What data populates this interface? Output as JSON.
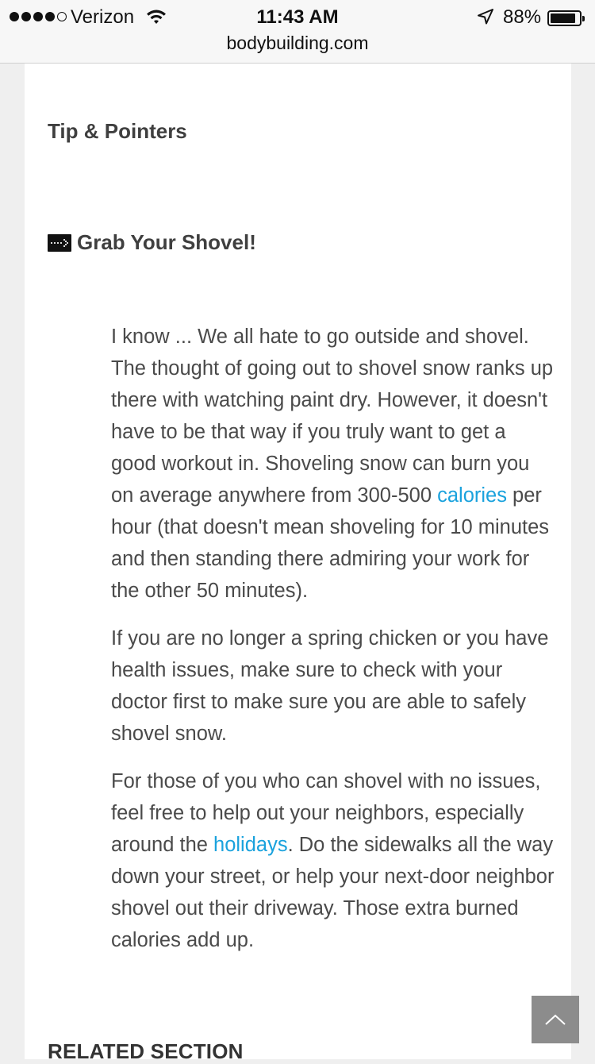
{
  "status_bar": {
    "carrier": "Verizon",
    "time": "11:43 AM",
    "battery_percent": "88%",
    "battery_level": 0.88,
    "url": "bodybuilding.com"
  },
  "article": {
    "section_title": "Tip & Pointers",
    "heading": "Grab Your Shovel!",
    "p1": {
      "before": "I know ... We all hate to go outside and shovel. The thought of going out to shovel snow ranks up there with watching paint dry. However, it doesn't have to be that way if you truly want to get a good workout in. Shoveling snow can burn you on average anywhere from 300-500 ",
      "link": "calories",
      "after": " per hour (that doesn't mean shoveling for 10 minutes and then standing there admiring your work for the other 50 minutes)."
    },
    "p2": "If you are no longer a spring chicken or you have health issues, make sure to check with your doctor first to make sure you are able to safely shovel snow.",
    "p3": {
      "before": "For those of you who can shovel with no issues, feel free to help out your neighbors, especially around the ",
      "link": "holidays",
      "after": ". Do the sidewalks all the way down your street, or help your next-door neighbor shovel out their driveway. Those extra burned calories add up."
    },
    "related_heading": "RELATED SECTION"
  },
  "colors": {
    "link": "#1aa2dd",
    "scroll_top_button": "#8c8c8c"
  }
}
